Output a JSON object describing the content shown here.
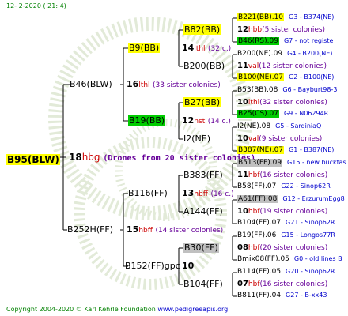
{
  "header": "12-  2-2020  (  21:  4)",
  "root": {
    "name": "B95(BLW)",
    "num": "18",
    "code": "hbg",
    "colonies": "(Drones from 20 sister colonies)"
  },
  "g1": [
    {
      "name": "B46(BLW)",
      "num": "16",
      "code": "lthl",
      "colonies": "(33 sister colonies)"
    },
    {
      "name": "B252H(FF)",
      "num": "15",
      "code": "hbff",
      "colonies": "(14 sister colonies)"
    }
  ],
  "g2": [
    {
      "name": "B9(BB)",
      "num": "14",
      "code": "lthl",
      "colonies": "(32 c.)"
    },
    {
      "name": "B19(BB)",
      "num": "12",
      "code": "nst",
      "colonies": "(14 c.)"
    },
    {
      "name": "B116(FF)",
      "num": "13",
      "code": "hbff",
      "colonies": "(16 c.)"
    },
    {
      "name": "B152(FF)gpc",
      "num": "10",
      "code": "",
      "colonies": ""
    }
  ],
  "g3": [
    {
      "name": "B82(BB)",
      "num": "12",
      "code": "hbb",
      "colonies": "(5 sister colonies)"
    },
    {
      "name": "B200(BB)",
      "num": "11",
      "code": "val",
      "colonies": "(12 sister colonies)"
    },
    {
      "name": "B27(BB)",
      "num": "10",
      "code": "lthl",
      "colonies": "(32 sister colonies)"
    },
    {
      "name": "I2(NE)",
      "num": "10",
      "code": "val",
      "colonies": "(9 sister colonies)"
    },
    {
      "name": "B383(FF)",
      "num": "11",
      "code": "hbf",
      "colonies": "(16 sister colonies)"
    },
    {
      "name": "A144(FF)",
      "num": "10",
      "code": "hbf",
      "colonies": "(19 sister colonies)"
    },
    {
      "name": "B30(FF)",
      "num": "08",
      "code": "hbf",
      "colonies": "(20 sister colonies)"
    },
    {
      "name": "B104(FF)",
      "num": "07",
      "code": "hbf",
      "colonies": "(16 sister colonies)"
    }
  ],
  "g4": [
    {
      "left": "B221(BB).10",
      "right": "G3 - B374(NE)"
    },
    {
      "left": "B46(RS).09",
      "right": "G7 - not registe"
    },
    {
      "left": "B200(NE).09",
      "right": "G4 - B200(NE)"
    },
    {
      "left": "B100(NE).07",
      "right": "G2 - B100(NE)"
    },
    {
      "left": "B53(BB).08",
      "right": "G6 - Bayburt98-3"
    },
    {
      "left": "B25(CS).07",
      "right": "G9 - N06294R"
    },
    {
      "left": "I2(NE).08",
      "right": "G5 - SardiniaQ"
    },
    {
      "left": "B387(NE).07",
      "right": "G1 - B387(NE)"
    },
    {
      "left": "B513(FF).09",
      "right": "G15 - new buckfas"
    },
    {
      "left": "B58(FF).07",
      "right": "G22 - Sinop62R"
    },
    {
      "left": "A61(FF).08",
      "right": "G12 - ErzurumEgg8"
    },
    {
      "left": "B104(FF).07",
      "right": "G21 - Sinop62R"
    },
    {
      "left": "B19(FF).06",
      "right": "G15 - Longos77R"
    },
    {
      "left": "Bmix08(FF).05",
      "right": "G0 - old lines B"
    },
    {
      "left": "B114(FF).05",
      "right": "G20 - Sinop62R"
    },
    {
      "left": "B811(FF).04",
      "right": "G27 - B-xx43"
    }
  ],
  "colors": {
    "highlight_yellow": "#ffff00",
    "highlight_green": "#00cc00",
    "highlight_gray": "#c0c0c0",
    "red": "#cc0000",
    "purple": "#660099",
    "blue": "#0000cc",
    "green": "#008000"
  },
  "footer": {
    "copyright": "Copyright 2004-2020 © Karl Kehrle Foundation",
    "link": "www.pedigreeapis.org"
  }
}
